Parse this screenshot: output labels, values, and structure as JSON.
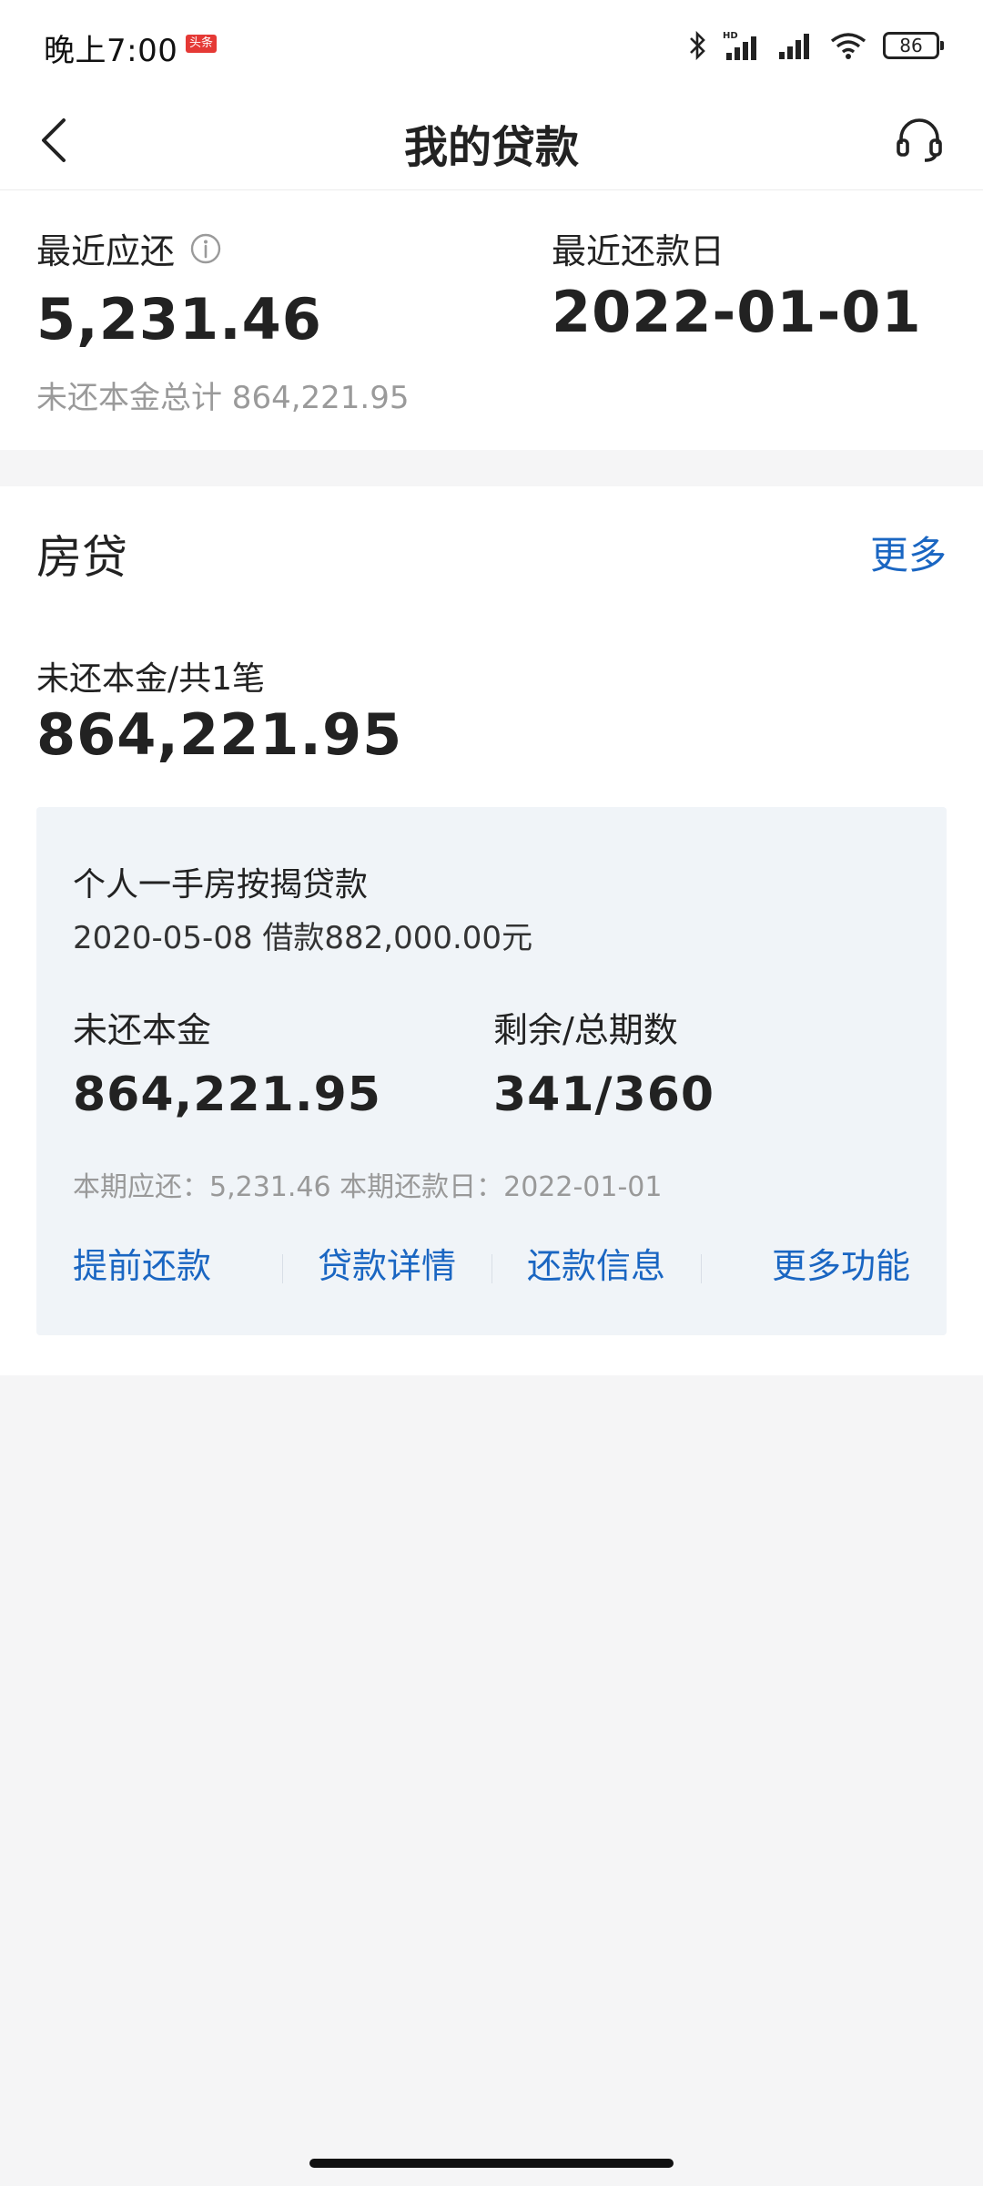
{
  "status_bar": {
    "time": "晚上7:00",
    "badge": "头条",
    "battery": "86",
    "icons": [
      "bluetooth-icon",
      "hd-signal-icon",
      "signal-icon",
      "wifi-icon",
      "battery-icon"
    ]
  },
  "header": {
    "title": "我的贷款",
    "back_icon": "chevron-left-icon",
    "service_icon": "headset-icon"
  },
  "summary": {
    "recent_due_label": "最近应还",
    "recent_due_amount": "5,231.46",
    "recent_due_date_label": "最近还款日",
    "recent_due_date": "2022-01-01",
    "total_principal_text": "未还本金总计 864,221.95"
  },
  "mortgage": {
    "title": "房贷",
    "more_label": "更多",
    "unpaid_label": "未还本金/共1笔",
    "unpaid_amount": "864,221.95",
    "loan": {
      "name": "个人一手房按揭贷款",
      "borrow_info": "2020-05-08 借款882,000.00元",
      "principal_label": "未还本金",
      "principal_value": "864,221.95",
      "periods_label": "剩余/总期数",
      "periods_value": "341/360",
      "period_info": "本期应还：5,231.46 本期还款日：2022-01-01",
      "actions": [
        "提前还款",
        "贷款详情",
        "还款信息",
        "更多功能"
      ]
    }
  },
  "colors": {
    "accent": "#1a66c2",
    "card_bg": "#f0f4f8",
    "page_bg": "#f5f5f6"
  }
}
